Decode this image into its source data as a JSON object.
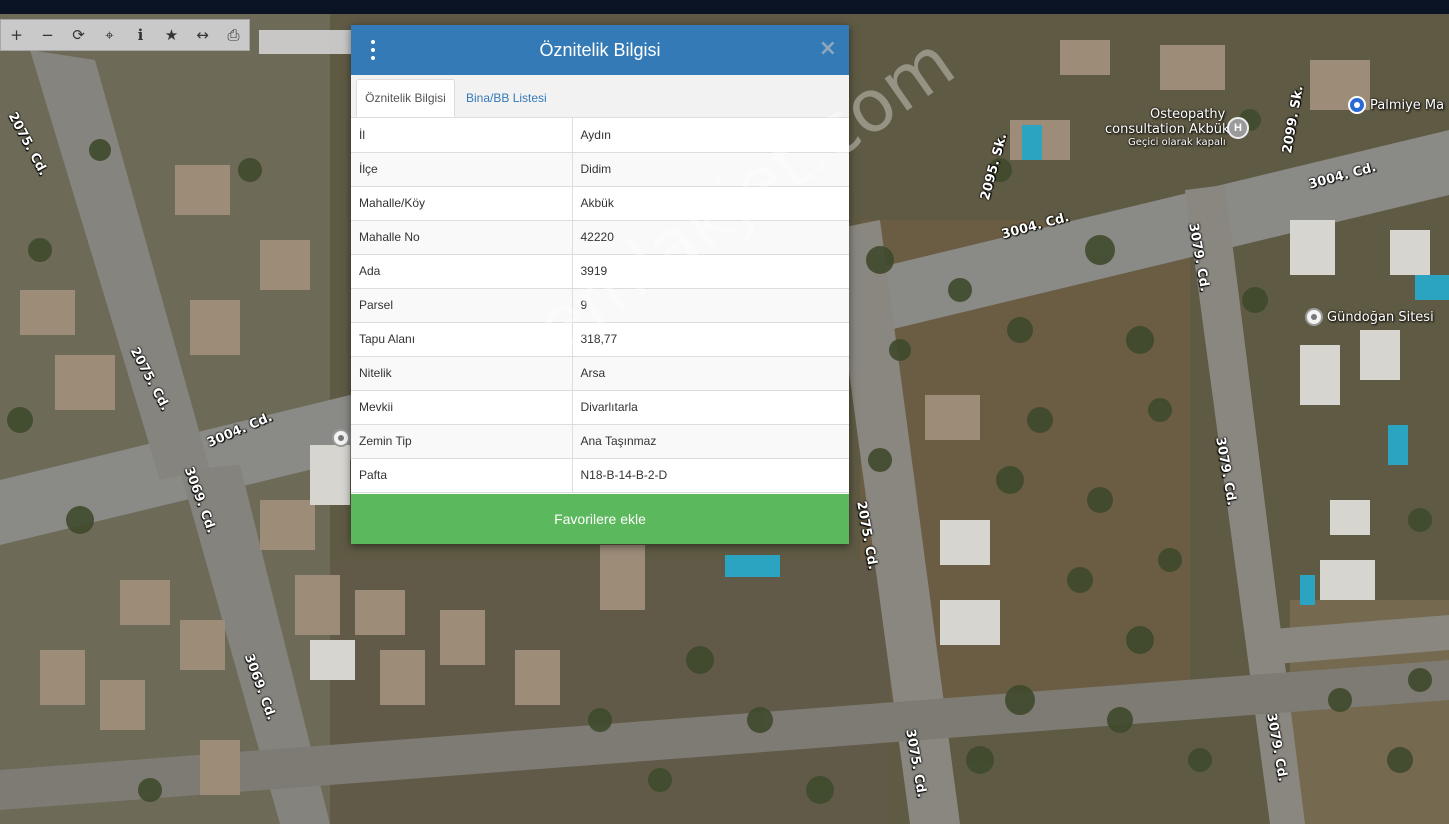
{
  "toolbar": {
    "tools": [
      {
        "name": "zoom-in",
        "glyph": "+"
      },
      {
        "name": "zoom-out",
        "glyph": "−"
      },
      {
        "name": "refresh",
        "glyph": "⟳"
      },
      {
        "name": "locate",
        "glyph": "⌖"
      },
      {
        "name": "info",
        "glyph": "i"
      },
      {
        "name": "favorite",
        "glyph": "★"
      },
      {
        "name": "measure",
        "glyph": "↔"
      },
      {
        "name": "print",
        "glyph": "⎙"
      }
    ]
  },
  "map": {
    "streets": [
      "2075. Cd.",
      "2075. Cd.",
      "3004. Cd.",
      "3004. Cd.",
      "3004. Cd.",
      "2095. Sk.",
      "2099. Sk.",
      "3079. Cd.",
      "3079. Cd.",
      "3079. Cd.",
      "3069. Cd.",
      "3069. Cd.",
      "2075. Cd.",
      "3075. Cd."
    ],
    "pois": {
      "palmiye": "Palmiye Ma",
      "gundogan": "Gündoğan Sitesi",
      "osteopathy_line1": "Osteopathy",
      "osteopathy_line2": "consultation Akbük",
      "osteopathy_status": "Geçici olarak kapalı"
    }
  },
  "modal": {
    "title": "Öznitelik Bilgisi",
    "close_glyph": "×",
    "tabs": [
      "Öznitelik Bilgisi",
      "Bina/BB Listesi"
    ],
    "rows": [
      {
        "key": "İl",
        "value": "Aydın"
      },
      {
        "key": "İlçe",
        "value": "Didim"
      },
      {
        "key": "Mahalle/Köy",
        "value": "Akbük"
      },
      {
        "key": "Mahalle No",
        "value": "42220"
      },
      {
        "key": "Ada",
        "value": "3919"
      },
      {
        "key": "Parsel",
        "value": "9"
      },
      {
        "key": "Tapu Alanı",
        "value": "318,77"
      },
      {
        "key": "Nitelik",
        "value": "Arsa"
      },
      {
        "key": "Mevkii",
        "value": "Divarlıtarla"
      },
      {
        "key": "Zemin Tip",
        "value": "Ana Taşınmaz"
      },
      {
        "key": "Pafta",
        "value": "N18-B-14-B-2-D"
      }
    ],
    "fav_label": "Favorilere ekle"
  },
  "watermark": "emlakjet.com",
  "colors": {
    "header": "#337ab7",
    "favorite": "#5cb85c",
    "link": "#337ab7"
  }
}
